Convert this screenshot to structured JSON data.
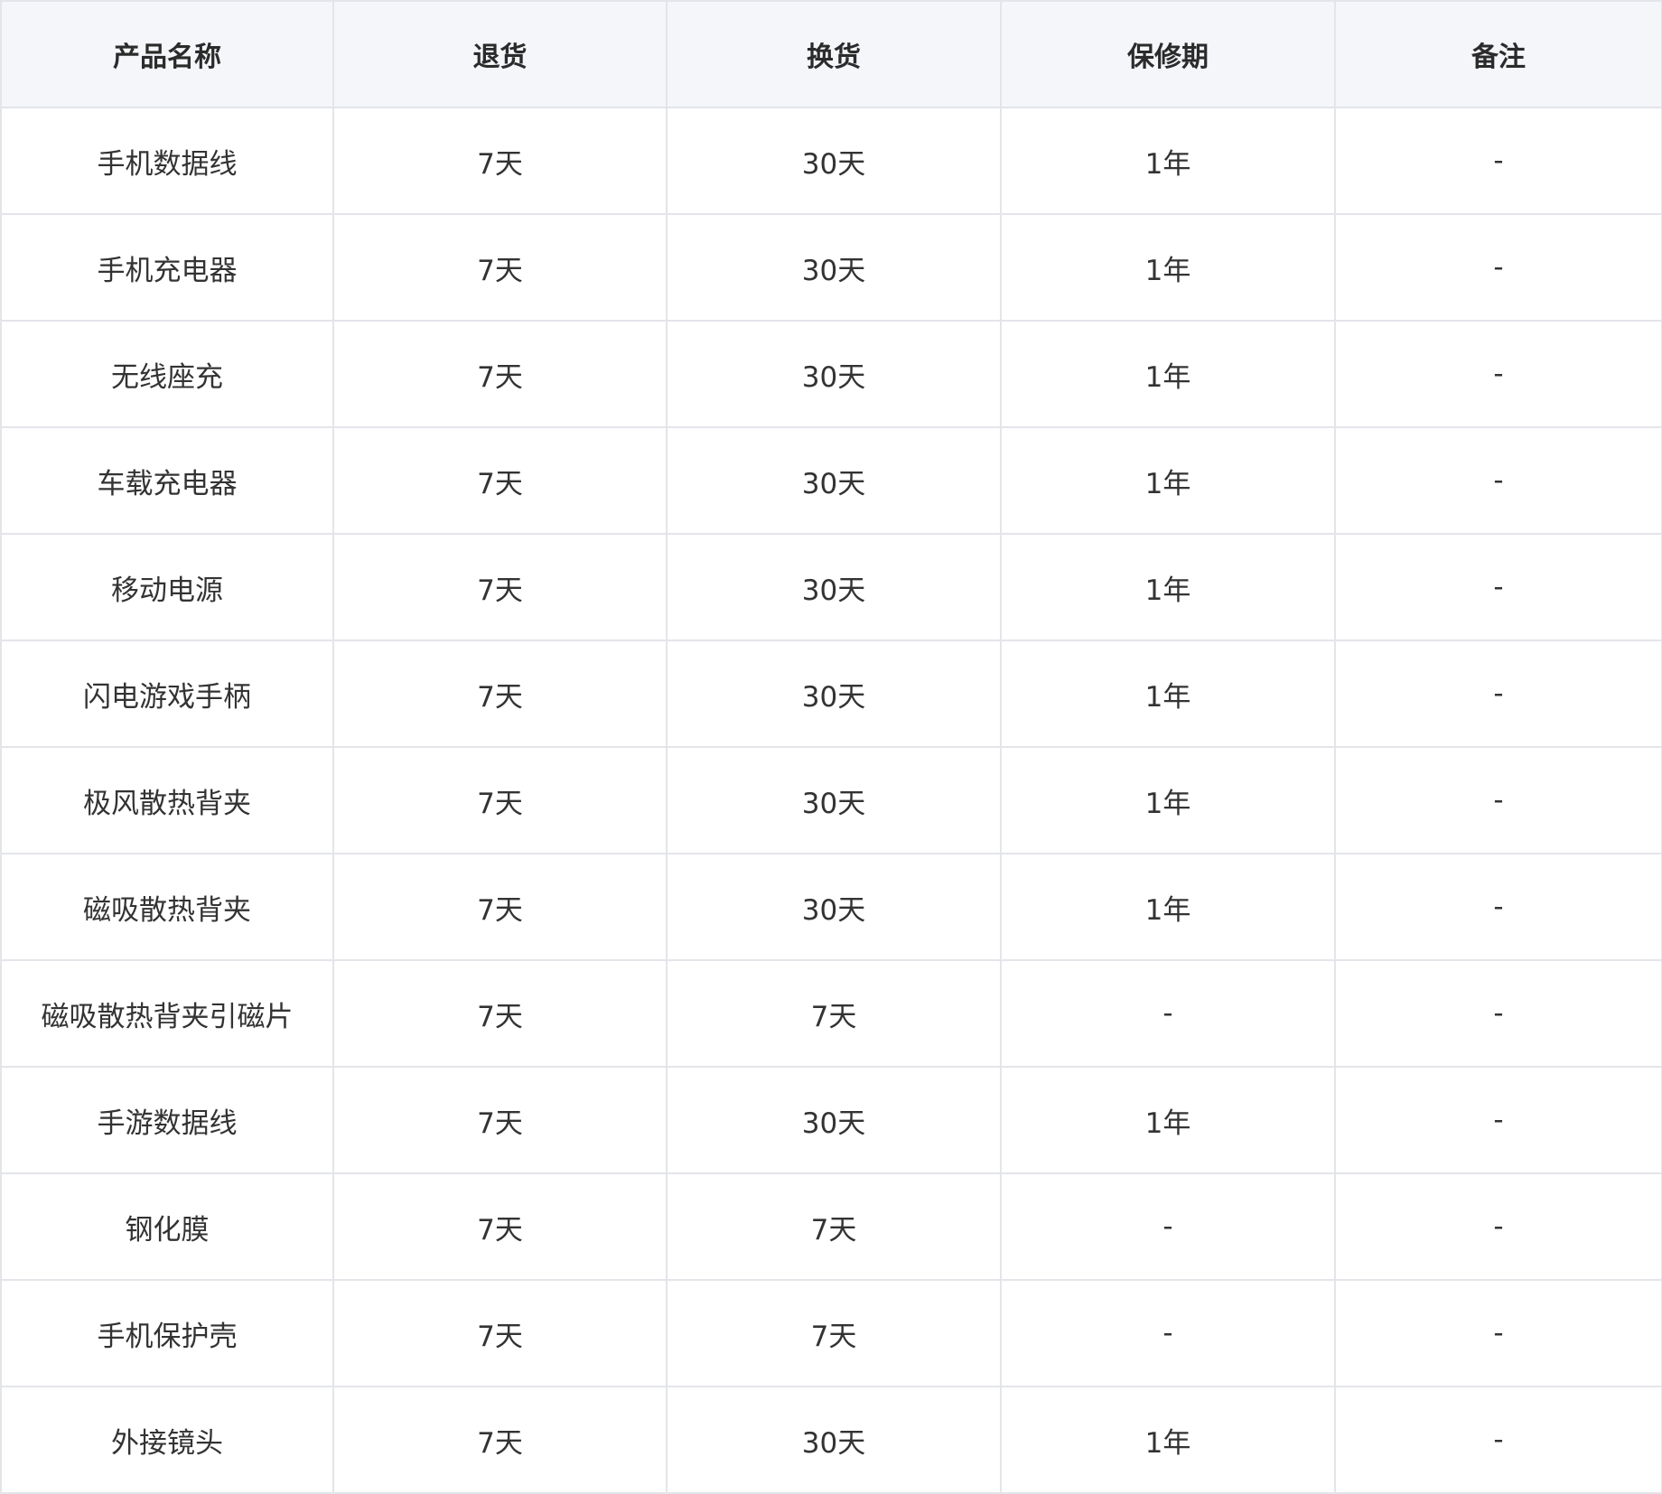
{
  "table": {
    "headers": [
      "产品名称",
      "退货",
      "换货",
      "保修期",
      "备注"
    ],
    "rows": [
      [
        "手机数据线",
        "7天",
        "30天",
        "1年",
        "-"
      ],
      [
        "手机充电器",
        "7天",
        "30天",
        "1年",
        "-"
      ],
      [
        "无线座充",
        "7天",
        "30天",
        "1年",
        "-"
      ],
      [
        "车载充电器",
        "7天",
        "30天",
        "1年",
        "-"
      ],
      [
        "移动电源",
        "7天",
        "30天",
        "1年",
        "-"
      ],
      [
        "闪电游戏手柄",
        "7天",
        "30天",
        "1年",
        "-"
      ],
      [
        "极风散热背夹",
        "7天",
        "30天",
        "1年",
        "-"
      ],
      [
        "磁吸散热背夹",
        "7天",
        "30天",
        "1年",
        "-"
      ],
      [
        "磁吸散热背夹引磁片",
        "7天",
        "7天",
        "-",
        "-"
      ],
      [
        "手游数据线",
        "7天",
        "30天",
        "1年",
        "-"
      ],
      [
        "钢化膜",
        "7天",
        "7天",
        "-",
        "-"
      ],
      [
        "手机保护壳",
        "7天",
        "7天",
        "-",
        "-"
      ],
      [
        "外接镜头",
        "7天",
        "30天",
        "1年",
        "-"
      ]
    ]
  }
}
